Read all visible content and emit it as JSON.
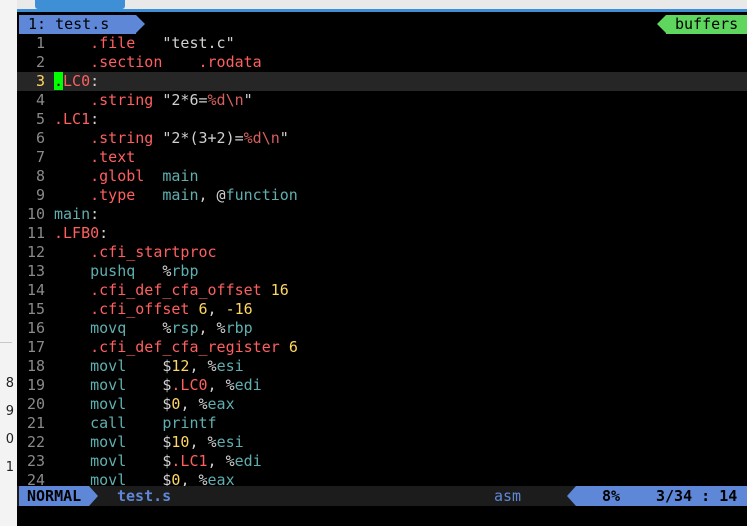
{
  "left_window": {
    "labels": [
      "8",
      "9",
      "0",
      "1"
    ]
  },
  "tabline": {
    "active_tab": "1: test.s",
    "buffers_label": "buffers"
  },
  "editor": {
    "current_line": 3,
    "lines": [
      {
        "n": "1",
        "tokens": [
          {
            "t": "    ",
            "c": "plain"
          },
          {
            "t": ".file",
            "c": "dir"
          },
          {
            "t": "   ",
            "c": "plain"
          },
          {
            "t": "\"test.c\"",
            "c": "str"
          }
        ]
      },
      {
        "n": "2",
        "tokens": [
          {
            "t": "    ",
            "c": "plain"
          },
          {
            "t": ".section",
            "c": "dir"
          },
          {
            "t": "    ",
            "c": "plain"
          },
          {
            "t": ".rodata",
            "c": "dir"
          }
        ]
      },
      {
        "n": "3",
        "tokens": [
          {
            "t": ".",
            "c": "cursor"
          },
          {
            "t": "LC0",
            "c": "lbl"
          },
          {
            "t": ":",
            "c": "plain"
          }
        ]
      },
      {
        "n": "4",
        "tokens": [
          {
            "t": "    ",
            "c": "plain"
          },
          {
            "t": ".string",
            "c": "dir"
          },
          {
            "t": " \"2*6=",
            "c": "str"
          },
          {
            "t": "%d",
            "c": "fmt"
          },
          {
            "t": "\\n",
            "c": "esc"
          },
          {
            "t": "\"",
            "c": "str"
          }
        ]
      },
      {
        "n": "5",
        "tokens": [
          {
            "t": ".LC1",
            "c": "lbl"
          },
          {
            "t": ":",
            "c": "plain"
          }
        ]
      },
      {
        "n": "6",
        "tokens": [
          {
            "t": "    ",
            "c": "plain"
          },
          {
            "t": ".string",
            "c": "dir"
          },
          {
            "t": " \"2*(3+2)=",
            "c": "str"
          },
          {
            "t": "%d",
            "c": "fmt"
          },
          {
            "t": "\\n",
            "c": "esc"
          },
          {
            "t": "\"",
            "c": "str"
          }
        ]
      },
      {
        "n": "7",
        "tokens": [
          {
            "t": "    ",
            "c": "plain"
          },
          {
            "t": ".text",
            "c": "dir"
          }
        ]
      },
      {
        "n": "8",
        "tokens": [
          {
            "t": "    ",
            "c": "plain"
          },
          {
            "t": ".globl",
            "c": "dir"
          },
          {
            "t": "  ",
            "c": "plain"
          },
          {
            "t": "main",
            "c": "id"
          }
        ]
      },
      {
        "n": "9",
        "tokens": [
          {
            "t": "    ",
            "c": "plain"
          },
          {
            "t": ".type",
            "c": "dir"
          },
          {
            "t": "   ",
            "c": "plain"
          },
          {
            "t": "main",
            "c": "id"
          },
          {
            "t": ", @",
            "c": "plain"
          },
          {
            "t": "function",
            "c": "id"
          }
        ]
      },
      {
        "n": "10",
        "tokens": [
          {
            "t": "main",
            "c": "id"
          },
          {
            "t": ":",
            "c": "plain"
          }
        ]
      },
      {
        "n": "11",
        "tokens": [
          {
            "t": ".LFB0",
            "c": "lbl"
          },
          {
            "t": ":",
            "c": "plain"
          }
        ]
      },
      {
        "n": "12",
        "tokens": [
          {
            "t": "    ",
            "c": "plain"
          },
          {
            "t": ".cfi_startproc",
            "c": "dir"
          }
        ]
      },
      {
        "n": "13",
        "tokens": [
          {
            "t": "    ",
            "c": "plain"
          },
          {
            "t": "pushq",
            "c": "ins"
          },
          {
            "t": "   %",
            "c": "plain"
          },
          {
            "t": "rbp",
            "c": "reg"
          }
        ]
      },
      {
        "n": "14",
        "tokens": [
          {
            "t": "    ",
            "c": "plain"
          },
          {
            "t": ".cfi_def_cfa_offset",
            "c": "dir"
          },
          {
            "t": " ",
            "c": "plain"
          },
          {
            "t": "16",
            "c": "num"
          }
        ]
      },
      {
        "n": "15",
        "tokens": [
          {
            "t": "    ",
            "c": "plain"
          },
          {
            "t": ".cfi_offset",
            "c": "dir"
          },
          {
            "t": " ",
            "c": "plain"
          },
          {
            "t": "6",
            "c": "num"
          },
          {
            "t": ", ",
            "c": "plain"
          },
          {
            "t": "-16",
            "c": "num"
          }
        ]
      },
      {
        "n": "16",
        "tokens": [
          {
            "t": "    ",
            "c": "plain"
          },
          {
            "t": "movq",
            "c": "ins"
          },
          {
            "t": "    %",
            "c": "plain"
          },
          {
            "t": "rsp",
            "c": "reg"
          },
          {
            "t": ", %",
            "c": "plain"
          },
          {
            "t": "rbp",
            "c": "reg"
          }
        ]
      },
      {
        "n": "17",
        "tokens": [
          {
            "t": "    ",
            "c": "plain"
          },
          {
            "t": ".cfi_def_cfa_register",
            "c": "dir"
          },
          {
            "t": " ",
            "c": "plain"
          },
          {
            "t": "6",
            "c": "num"
          }
        ]
      },
      {
        "n": "18",
        "tokens": [
          {
            "t": "    ",
            "c": "plain"
          },
          {
            "t": "movl",
            "c": "ins"
          },
          {
            "t": "    $",
            "c": "plain"
          },
          {
            "t": "12",
            "c": "num"
          },
          {
            "t": ", %",
            "c": "plain"
          },
          {
            "t": "esi",
            "c": "reg"
          }
        ]
      },
      {
        "n": "19",
        "tokens": [
          {
            "t": "    ",
            "c": "plain"
          },
          {
            "t": "movl",
            "c": "ins"
          },
          {
            "t": "    $",
            "c": "plain"
          },
          {
            "t": ".LC0",
            "c": "lbl"
          },
          {
            "t": ", %",
            "c": "plain"
          },
          {
            "t": "edi",
            "c": "reg"
          }
        ]
      },
      {
        "n": "20",
        "tokens": [
          {
            "t": "    ",
            "c": "plain"
          },
          {
            "t": "movl",
            "c": "ins"
          },
          {
            "t": "    $",
            "c": "plain"
          },
          {
            "t": "0",
            "c": "num"
          },
          {
            "t": ", %",
            "c": "plain"
          },
          {
            "t": "eax",
            "c": "reg"
          }
        ]
      },
      {
        "n": "21",
        "tokens": [
          {
            "t": "    ",
            "c": "plain"
          },
          {
            "t": "call",
            "c": "ins"
          },
          {
            "t": "    ",
            "c": "plain"
          },
          {
            "t": "printf",
            "c": "func"
          }
        ]
      },
      {
        "n": "22",
        "tokens": [
          {
            "t": "    ",
            "c": "plain"
          },
          {
            "t": "movl",
            "c": "ins"
          },
          {
            "t": "    $",
            "c": "plain"
          },
          {
            "t": "10",
            "c": "num"
          },
          {
            "t": ", %",
            "c": "plain"
          },
          {
            "t": "esi",
            "c": "reg"
          }
        ]
      },
      {
        "n": "23",
        "tokens": [
          {
            "t": "    ",
            "c": "plain"
          },
          {
            "t": "movl",
            "c": "ins"
          },
          {
            "t": "    $",
            "c": "plain"
          },
          {
            "t": ".LC1",
            "c": "lbl"
          },
          {
            "t": ", %",
            "c": "plain"
          },
          {
            "t": "edi",
            "c": "reg"
          }
        ]
      },
      {
        "n": "24",
        "tokens": [
          {
            "t": "    ",
            "c": "plain"
          },
          {
            "t": "movl",
            "c": "ins"
          },
          {
            "t": "    $",
            "c": "plain"
          },
          {
            "t": "0",
            "c": "num"
          },
          {
            "t": ", %",
            "c": "plain"
          },
          {
            "t": "eax",
            "c": "reg"
          }
        ]
      }
    ]
  },
  "statusline": {
    "mode": "NORMAL",
    "filename": "test.s",
    "filetype": "asm",
    "percent": "8%",
    "line_col": "3/34 :  14"
  },
  "colors": {
    "background": "#000000",
    "mode_blue": "#5f87d7",
    "buffers_green": "#5fd75f",
    "cursor_green": "#00ff00",
    "directive": "#ff5f5f",
    "register": "#5fafaf",
    "number": "#ffd75f"
  }
}
